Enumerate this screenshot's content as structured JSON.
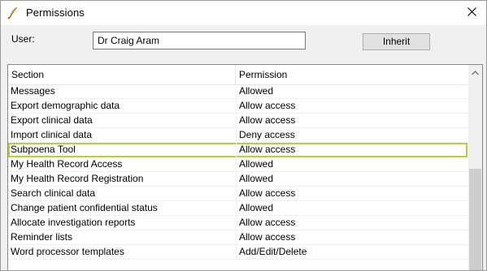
{
  "window": {
    "title": "Permissions"
  },
  "user": {
    "label": "User:",
    "value": "Dr Craig Aram"
  },
  "buttons": {
    "inherit": "Inherit"
  },
  "grid": {
    "columns": [
      "Section",
      "Permission"
    ],
    "rows": [
      {
        "section": "Messages",
        "permission": "Allowed"
      },
      {
        "section": "Export demographic data",
        "permission": "Allow access"
      },
      {
        "section": "Export clinical data",
        "permission": "Allow access"
      },
      {
        "section": "Import clinical data",
        "permission": "Deny access"
      },
      {
        "section": "Subpoena Tool",
        "permission": "Allow access"
      },
      {
        "section": "My Health Record Access",
        "permission": "Allowed"
      },
      {
        "section": "My Health Record Registration",
        "permission": "Allowed"
      },
      {
        "section": "Search clinical data",
        "permission": "Allow access"
      },
      {
        "section": "Change patient confidential status",
        "permission": "Allowed"
      },
      {
        "section": "Allocate investigation reports",
        "permission": "Allow access"
      },
      {
        "section": "Reminder lists",
        "permission": "Allow access"
      },
      {
        "section": "Word processor templates",
        "permission": "Add/Edit/Delete"
      }
    ],
    "selected_row": "Subpoena Tool"
  },
  "colors": {
    "selection_border": "#b5cf3e",
    "window_background": "#f0f0f0"
  },
  "icons": {
    "app": "quill-pen-icon",
    "close": "close-icon",
    "scroll_up": "chevron-up-icon"
  }
}
